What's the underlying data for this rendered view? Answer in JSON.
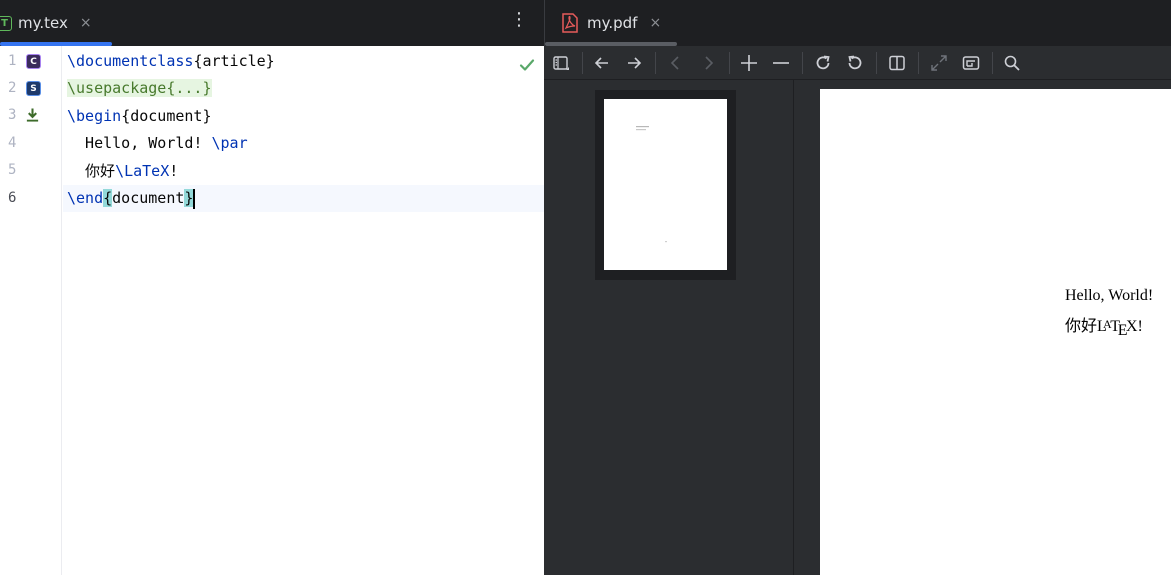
{
  "editor": {
    "tab": {
      "label": "my.tex",
      "icon_letter": "T",
      "close": "×"
    },
    "menu_glyph": "⋮",
    "gutter_icons": {
      "class_letter": "C",
      "package_letter": "S"
    },
    "line_numbers": [
      "1",
      "2",
      "3",
      "4",
      "5",
      "6"
    ],
    "lines": {
      "l1": {
        "cmd": "\\documentclass",
        "arg": "{article}"
      },
      "l2": {
        "folded": "\\usepackage{...}"
      },
      "l3": {
        "cmd": "\\begin",
        "arg": "{document}"
      },
      "l4": {
        "text": "  Hello, World! ",
        "cmd": "\\par"
      },
      "l5": {
        "text": "  你好",
        "cmd": "\\LaTeX",
        "tail": "!"
      },
      "l6": {
        "cmd": "\\end",
        "open": "{",
        "arg": "document",
        "close": "}"
      }
    },
    "colors": {
      "keyword": "#0033b3",
      "accent": "#3574f0",
      "check": "#59a869"
    }
  },
  "pdf": {
    "tab": {
      "label": "my.pdf",
      "close": "×"
    },
    "toolbar_icons": [
      "toggle-sidebar-icon",
      "back-arrow-icon",
      "forward-arrow-icon",
      "previous-page-icon",
      "next-page-icon",
      "zoom-in-icon",
      "zoom-out-icon",
      "rotate-clockwise-icon",
      "rotate-counterclockwise-icon",
      "split-view-icon",
      "fullscreen-icon",
      "fit-page-icon",
      "search-icon"
    ],
    "page": {
      "line1": "Hello, World!",
      "line2_prefix": "你好",
      "logo": {
        "L": "L",
        "A": "A",
        "T": "T",
        "E": "E",
        "X": "X"
      },
      "line2_suffix": "!"
    }
  }
}
